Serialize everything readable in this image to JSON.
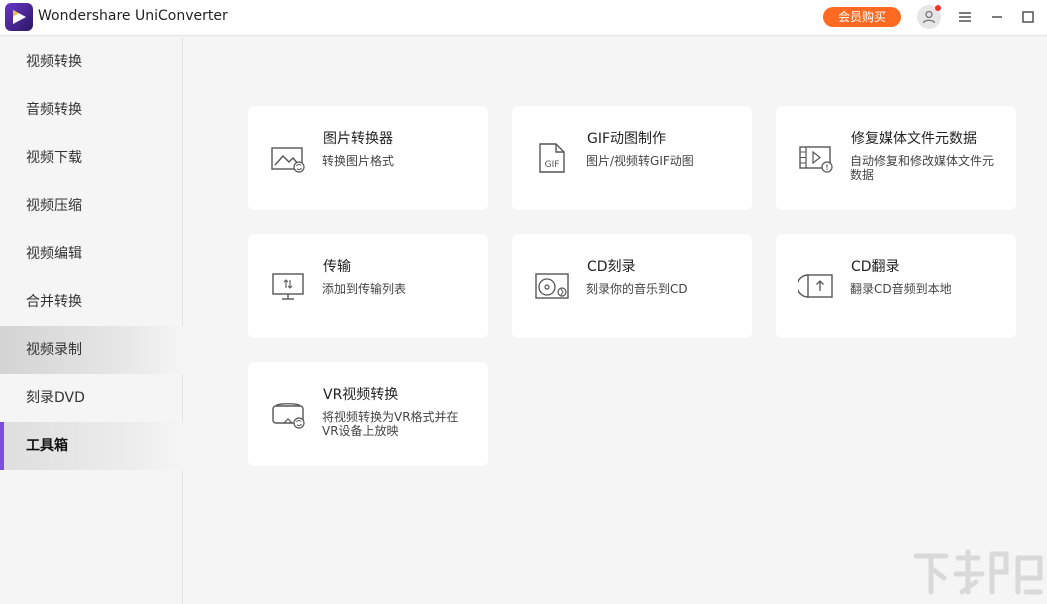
{
  "app": {
    "title": "Wondershare UniConverter"
  },
  "header": {
    "vip_label": "会员购买"
  },
  "sidebar": {
    "items": [
      {
        "label": "视频转换"
      },
      {
        "label": "音频转换"
      },
      {
        "label": "视频下载"
      },
      {
        "label": "视频压缩"
      },
      {
        "label": "视频编辑"
      },
      {
        "label": "合并转换"
      },
      {
        "label": "视频录制",
        "state": "hover"
      },
      {
        "label": "刻录DVD"
      },
      {
        "label": "工具箱",
        "state": "active"
      }
    ]
  },
  "tools": [
    {
      "title": "图片转换器",
      "desc": "转换图片格式",
      "icon": "image-convert-icon"
    },
    {
      "title": "GIF动图制作",
      "desc": "图片/视频转GIF动图",
      "icon": "gif-icon"
    },
    {
      "title": "修复媒体文件元数据",
      "desc": "自动修复和修改媒体文件元数据",
      "icon": "metadata-icon"
    },
    {
      "title": "传输",
      "desc": "添加到传输列表",
      "icon": "transfer-icon"
    },
    {
      "title": "CD刻录",
      "desc": "刻录你的音乐到CD",
      "icon": "cd-burn-icon"
    },
    {
      "title": "CD翻录",
      "desc": "翻录CD音频到本地",
      "icon": "cd-rip-icon"
    },
    {
      "title": "VR视频转换",
      "desc": "将视频转换为VR格式并在VR设备上放映",
      "icon": "vr-icon"
    }
  ],
  "colors": {
    "accent": "#7c4ee0",
    "vip": "#ff6a22",
    "card_bg": "#ffffff",
    "content_bg": "#f5f5f5"
  }
}
